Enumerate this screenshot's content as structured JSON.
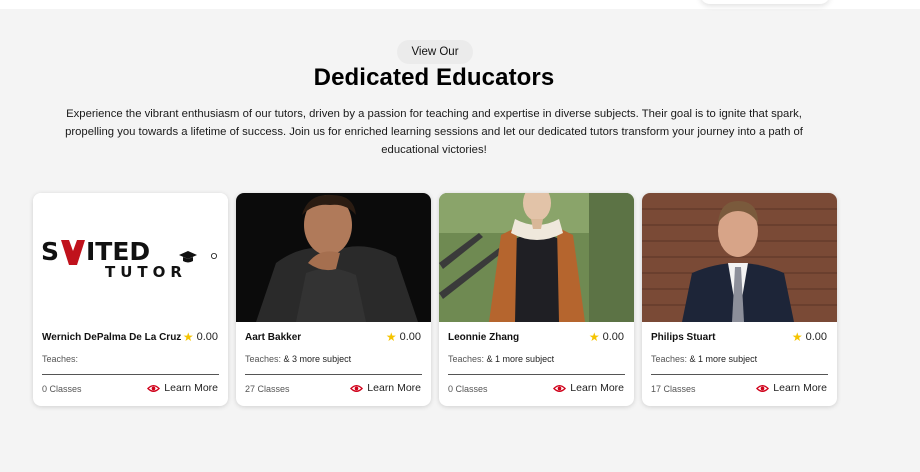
{
  "section": {
    "eyebrow": "View Our",
    "title": "Dedicated Educators",
    "intro": "Experience the vibrant enthusiasm of our tutors, driven by a passion for teaching and expertise in diverse subjects. Their goal is to ignite that spark, propelling you towards a lifetime of success. Join us for enriched learning sessions and let our dedicated tutors transform your journey into a path of educational victories!"
  },
  "colors": {
    "star": "#f5c400",
    "eye": "#d0021b",
    "background": "#f4f4f4"
  },
  "icons": {
    "star": "star-icon",
    "learn": "eye-icon"
  },
  "tutors": [
    {
      "name": "Wernich DePalma De La Cruz",
      "rating": "0.00",
      "teaches_label": "Teaches:",
      "teaches_more": "",
      "classes": "0 Classes",
      "learn_label": "Learn More",
      "logo_line1": "SUITED",
      "logo_line2": "TUTOR"
    },
    {
      "name": "Aart Bakker",
      "rating": "0.00",
      "teaches_label": "Teaches:",
      "teaches_more": "& 3 more subject",
      "classes": "27 Classes",
      "learn_label": "Learn More"
    },
    {
      "name": "Leonnie Zhang",
      "rating": "0.00",
      "teaches_label": "Teaches:",
      "teaches_more": "& 1 more subject",
      "classes": "0 Classes",
      "learn_label": "Learn More"
    },
    {
      "name": "Philips Stuart",
      "rating": "0.00",
      "teaches_label": "Teaches:",
      "teaches_more": "& 1 more subject",
      "classes": "17 Classes",
      "learn_label": "Learn More"
    }
  ]
}
